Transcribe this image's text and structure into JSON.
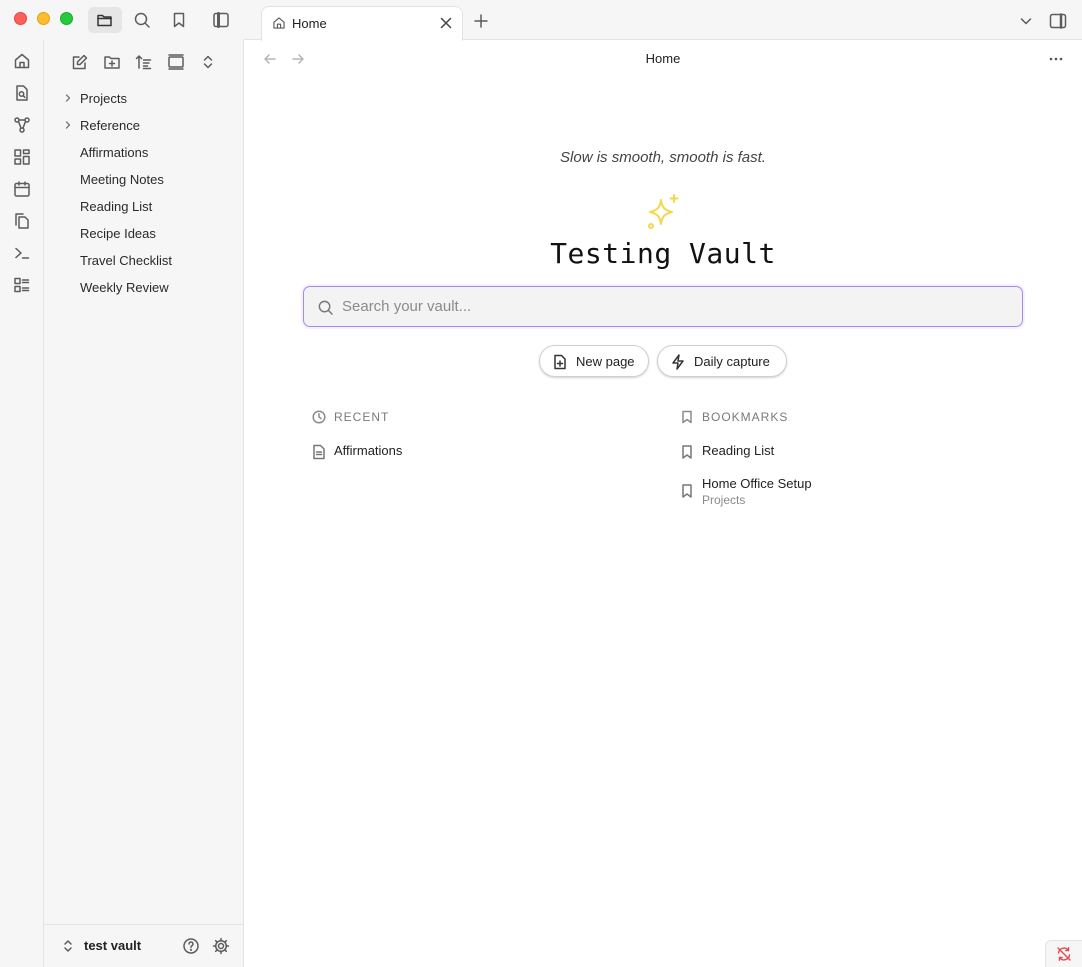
{
  "window": {
    "traffic_lights": [
      "close",
      "minimize",
      "maximize"
    ]
  },
  "titlebar": {
    "buttons": [
      "files-icon",
      "search-icon",
      "bookmark-icon",
      "sidebar-toggle-icon"
    ]
  },
  "ribbon": {
    "items": [
      "home-icon",
      "search-file-icon",
      "graph-icon",
      "canvas-icon",
      "calendar-icon",
      "copy-icon",
      "terminal-icon",
      "outline-icon"
    ]
  },
  "explorer": {
    "toolbar": [
      "new-note-icon",
      "new-folder-icon",
      "sort-icon",
      "collapse-view-icon",
      "expand-collapse-icon"
    ],
    "tree": [
      {
        "label": "Projects",
        "folder": true
      },
      {
        "label": "Reference",
        "folder": true
      },
      {
        "label": "Affirmations",
        "folder": false
      },
      {
        "label": "Meeting Notes",
        "folder": false
      },
      {
        "label": "Reading List",
        "folder": false
      },
      {
        "label": "Recipe Ideas",
        "folder": false
      },
      {
        "label": "Travel Checklist",
        "folder": false
      },
      {
        "label": "Weekly Review",
        "folder": false
      }
    ],
    "vault_name": "test vault"
  },
  "tabs": [
    {
      "label": "Home",
      "icon": "home-icon",
      "active": true
    }
  ],
  "view": {
    "title": "Home"
  },
  "home": {
    "quote": "Slow is smooth, smooth is fast.",
    "vault_title": "Testing Vault",
    "search_placeholder": "Search your vault...",
    "new_page_label": "New page",
    "daily_capture_label": "Daily capture",
    "recent_heading": "RECENT",
    "bookmarks_heading": "BOOKMARKS",
    "recent": [
      {
        "label": "Affirmations"
      }
    ],
    "bookmarks": [
      {
        "label": "Reading List",
        "sub": ""
      },
      {
        "label": "Home Office Setup",
        "sub": "Projects"
      }
    ]
  },
  "colors": {
    "accent": "#a88be8",
    "sparkle": "#f1d94a",
    "sync_error": "#e5484d"
  }
}
